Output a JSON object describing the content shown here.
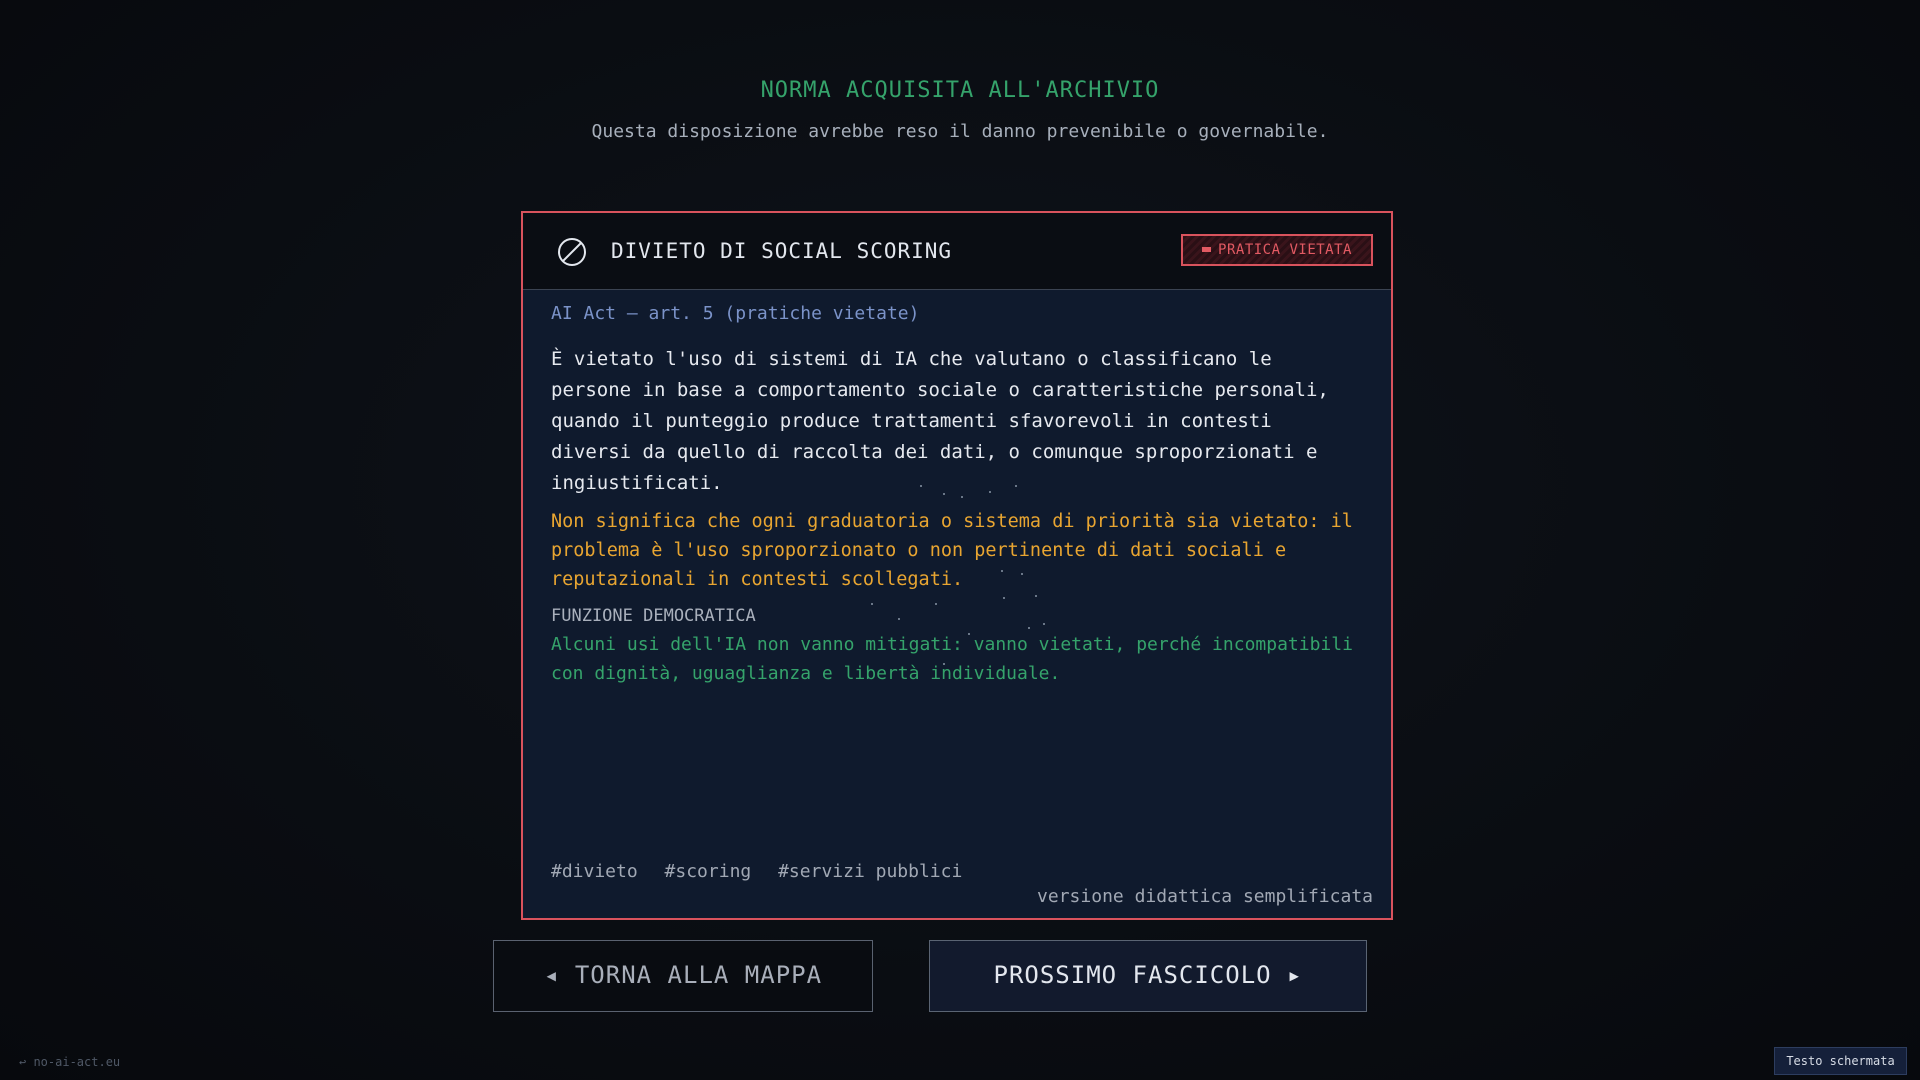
{
  "header": {
    "title": "NORMA ACQUISITA ALL'ARCHIVIO",
    "subtitle": "Questa disposizione avrebbe reso il danno prevenibile o governabile."
  },
  "card": {
    "icon": "prohibited-icon",
    "title": "DIVIETO DI SOCIAL SCORING",
    "badge": "PRATICA VIETATA",
    "reference": "AI Act — art. 5 (pratiche vietate)",
    "main_text": "È vietato l'uso di sistemi di IA che valutano o classificano le persone in base a comportamento sociale o caratteristiche personali, quando il punteggio produce trattamenti sfavorevoli in contesti diversi da quello di raccolta dei dati, o comunque sproporzionati e ingiustificati.",
    "note": "Non significa che ogni graduatoria o sistema di priorità sia vietato: il problema è l'uso sproporzionato o non pertinente di dati sociali e reputazionali in contesti scollegati.",
    "section_label": "FUNZIONE DEMOCRATICA",
    "section_text": "Alcuni usi dell'IA non vanno mitigati: vanno vietati, perché incompatibili con dignità, uguaglianza e libertà individuale.",
    "tags": [
      "#divieto",
      "#scoring",
      "#servizi pubblici"
    ],
    "edition": "versione didattica semplificata"
  },
  "buttons": {
    "back": "◂ TORNA ALLA MAPPA",
    "next": "PROSSIMO FASCICOLO ▸"
  },
  "footer": {
    "site": "↩ no-ai-act.eu",
    "screen_text": "Testo schermata"
  },
  "colors": {
    "accent_red": "#d9535d",
    "accent_green": "#35a36b",
    "accent_amber": "#e8a531",
    "reference_blue": "#7b93c9"
  }
}
